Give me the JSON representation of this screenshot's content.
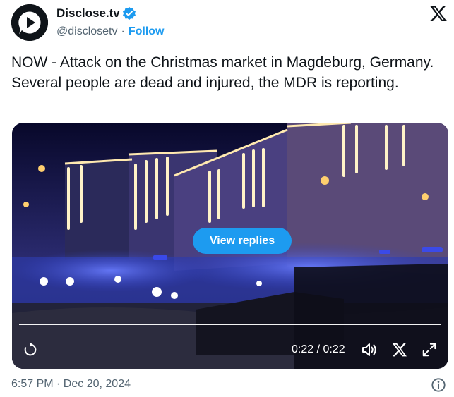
{
  "account": {
    "display_name": "Disclose.tv",
    "handle": "@disclosetv",
    "separator": "·",
    "follow_label": "Follow",
    "avatar_icon": "play-icon",
    "verified_icon": "verified-badge-icon",
    "verified_color": "#1d9bf0"
  },
  "brand": {
    "logo_icon": "x-logo-icon"
  },
  "tweet": {
    "text": "NOW - Attack on the Christmas market in Magdeburg, Germany. Several people are dead and injured, the MDR is reporting."
  },
  "media": {
    "view_replies_label": "View replies",
    "time_display": "0:22 / 0:22",
    "progress": 1.0,
    "controls": {
      "replay_icon": "replay-icon",
      "volume_icon": "volume-icon",
      "close_icon": "close-icon",
      "fullscreen_icon": "fullscreen-icon"
    }
  },
  "footer": {
    "timestamp": "6:57 PM · Dec 20, 2024",
    "info_icon": "info-icon"
  },
  "colors": {
    "accent": "#1d9bf0",
    "text": "#0f1419",
    "secondary_text": "#536471"
  }
}
